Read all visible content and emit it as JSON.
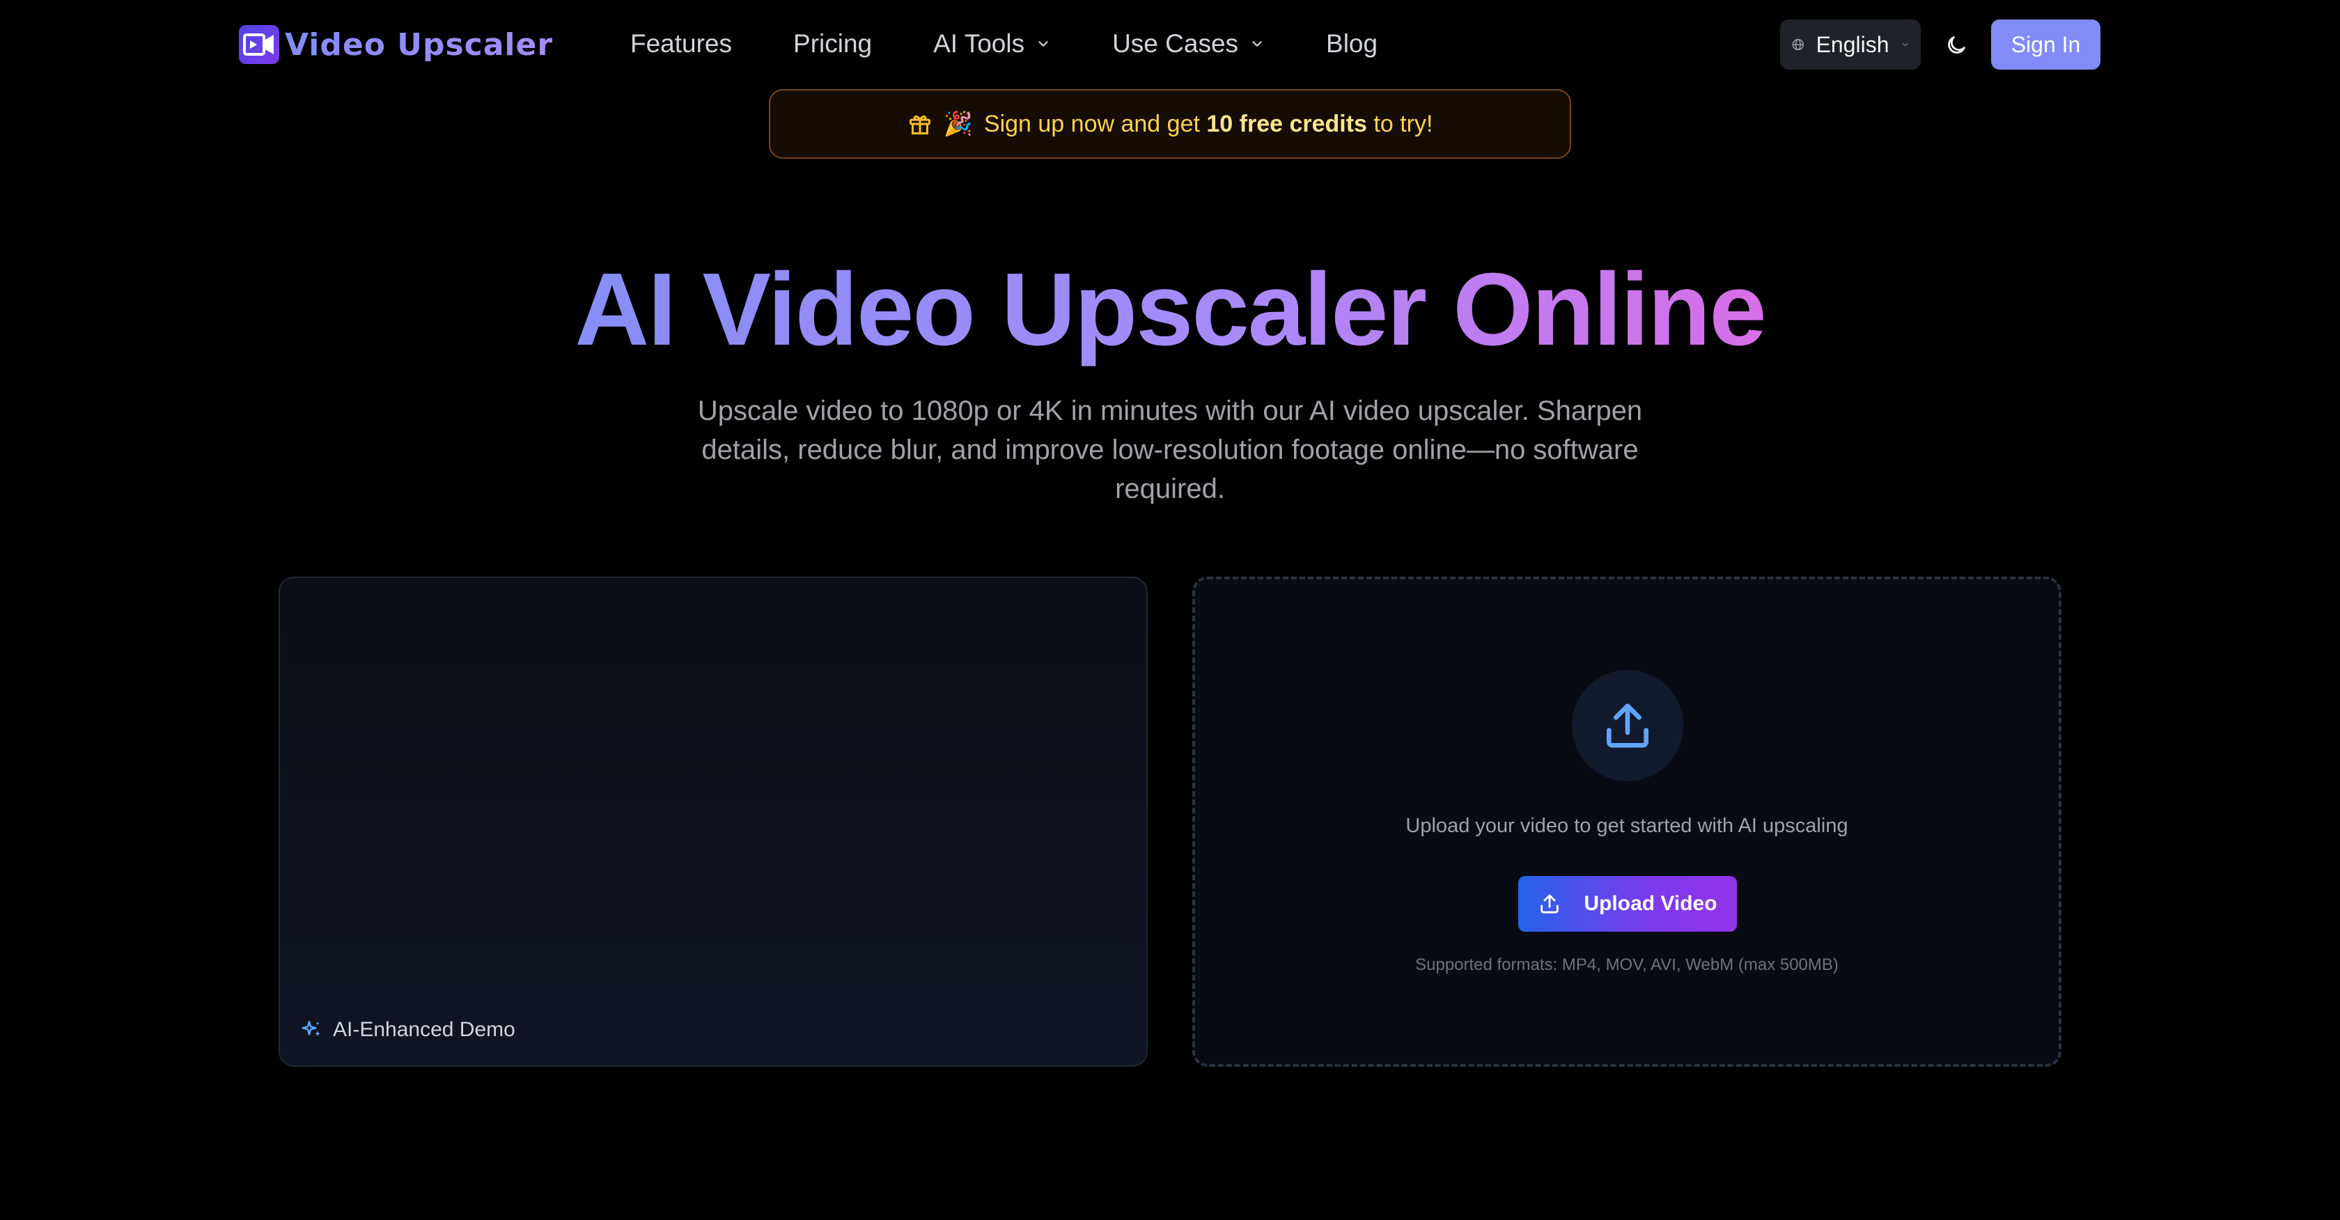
{
  "nav": {
    "logo_text": "Video Upscaler",
    "links": [
      {
        "label": "Features",
        "has_dropdown": false
      },
      {
        "label": "Pricing",
        "has_dropdown": false
      },
      {
        "label": "AI Tools",
        "has_dropdown": true
      },
      {
        "label": "Use Cases",
        "has_dropdown": true
      },
      {
        "label": "Blog",
        "has_dropdown": false
      }
    ],
    "language": "English",
    "theme_icon": "moon-icon",
    "signin_label": "Sign In"
  },
  "promo": {
    "icons": [
      "gift-icon",
      "party-popper-emoji"
    ],
    "emoji": "🎉",
    "text_before": "Sign up now and get ",
    "text_bold": "10 free credits",
    "text_after": " to try!"
  },
  "hero": {
    "title": "AI Video Upscaler Online",
    "subtitle": "Upscale video to 1080p or 4K in minutes with our AI video upscaler. Sharpen details, reduce blur, and improve low-resolution footage online—no software required."
  },
  "demo": {
    "badge_icon": "sparkles-icon",
    "badge_label": "AI-Enhanced Demo"
  },
  "upload": {
    "icon": "upload-icon",
    "prompt": "Upload your video to get started with AI upscaling",
    "button_label": "Upload Video",
    "formats": "Supported formats: MP4, MOV, AVI, WebM (max 500MB)"
  },
  "colors": {
    "background": "#000000",
    "accent": "#818cf8",
    "promo_text": "#fcd34d",
    "promo_border": "#7a4418",
    "upload_icon": "#60a5fa"
  }
}
